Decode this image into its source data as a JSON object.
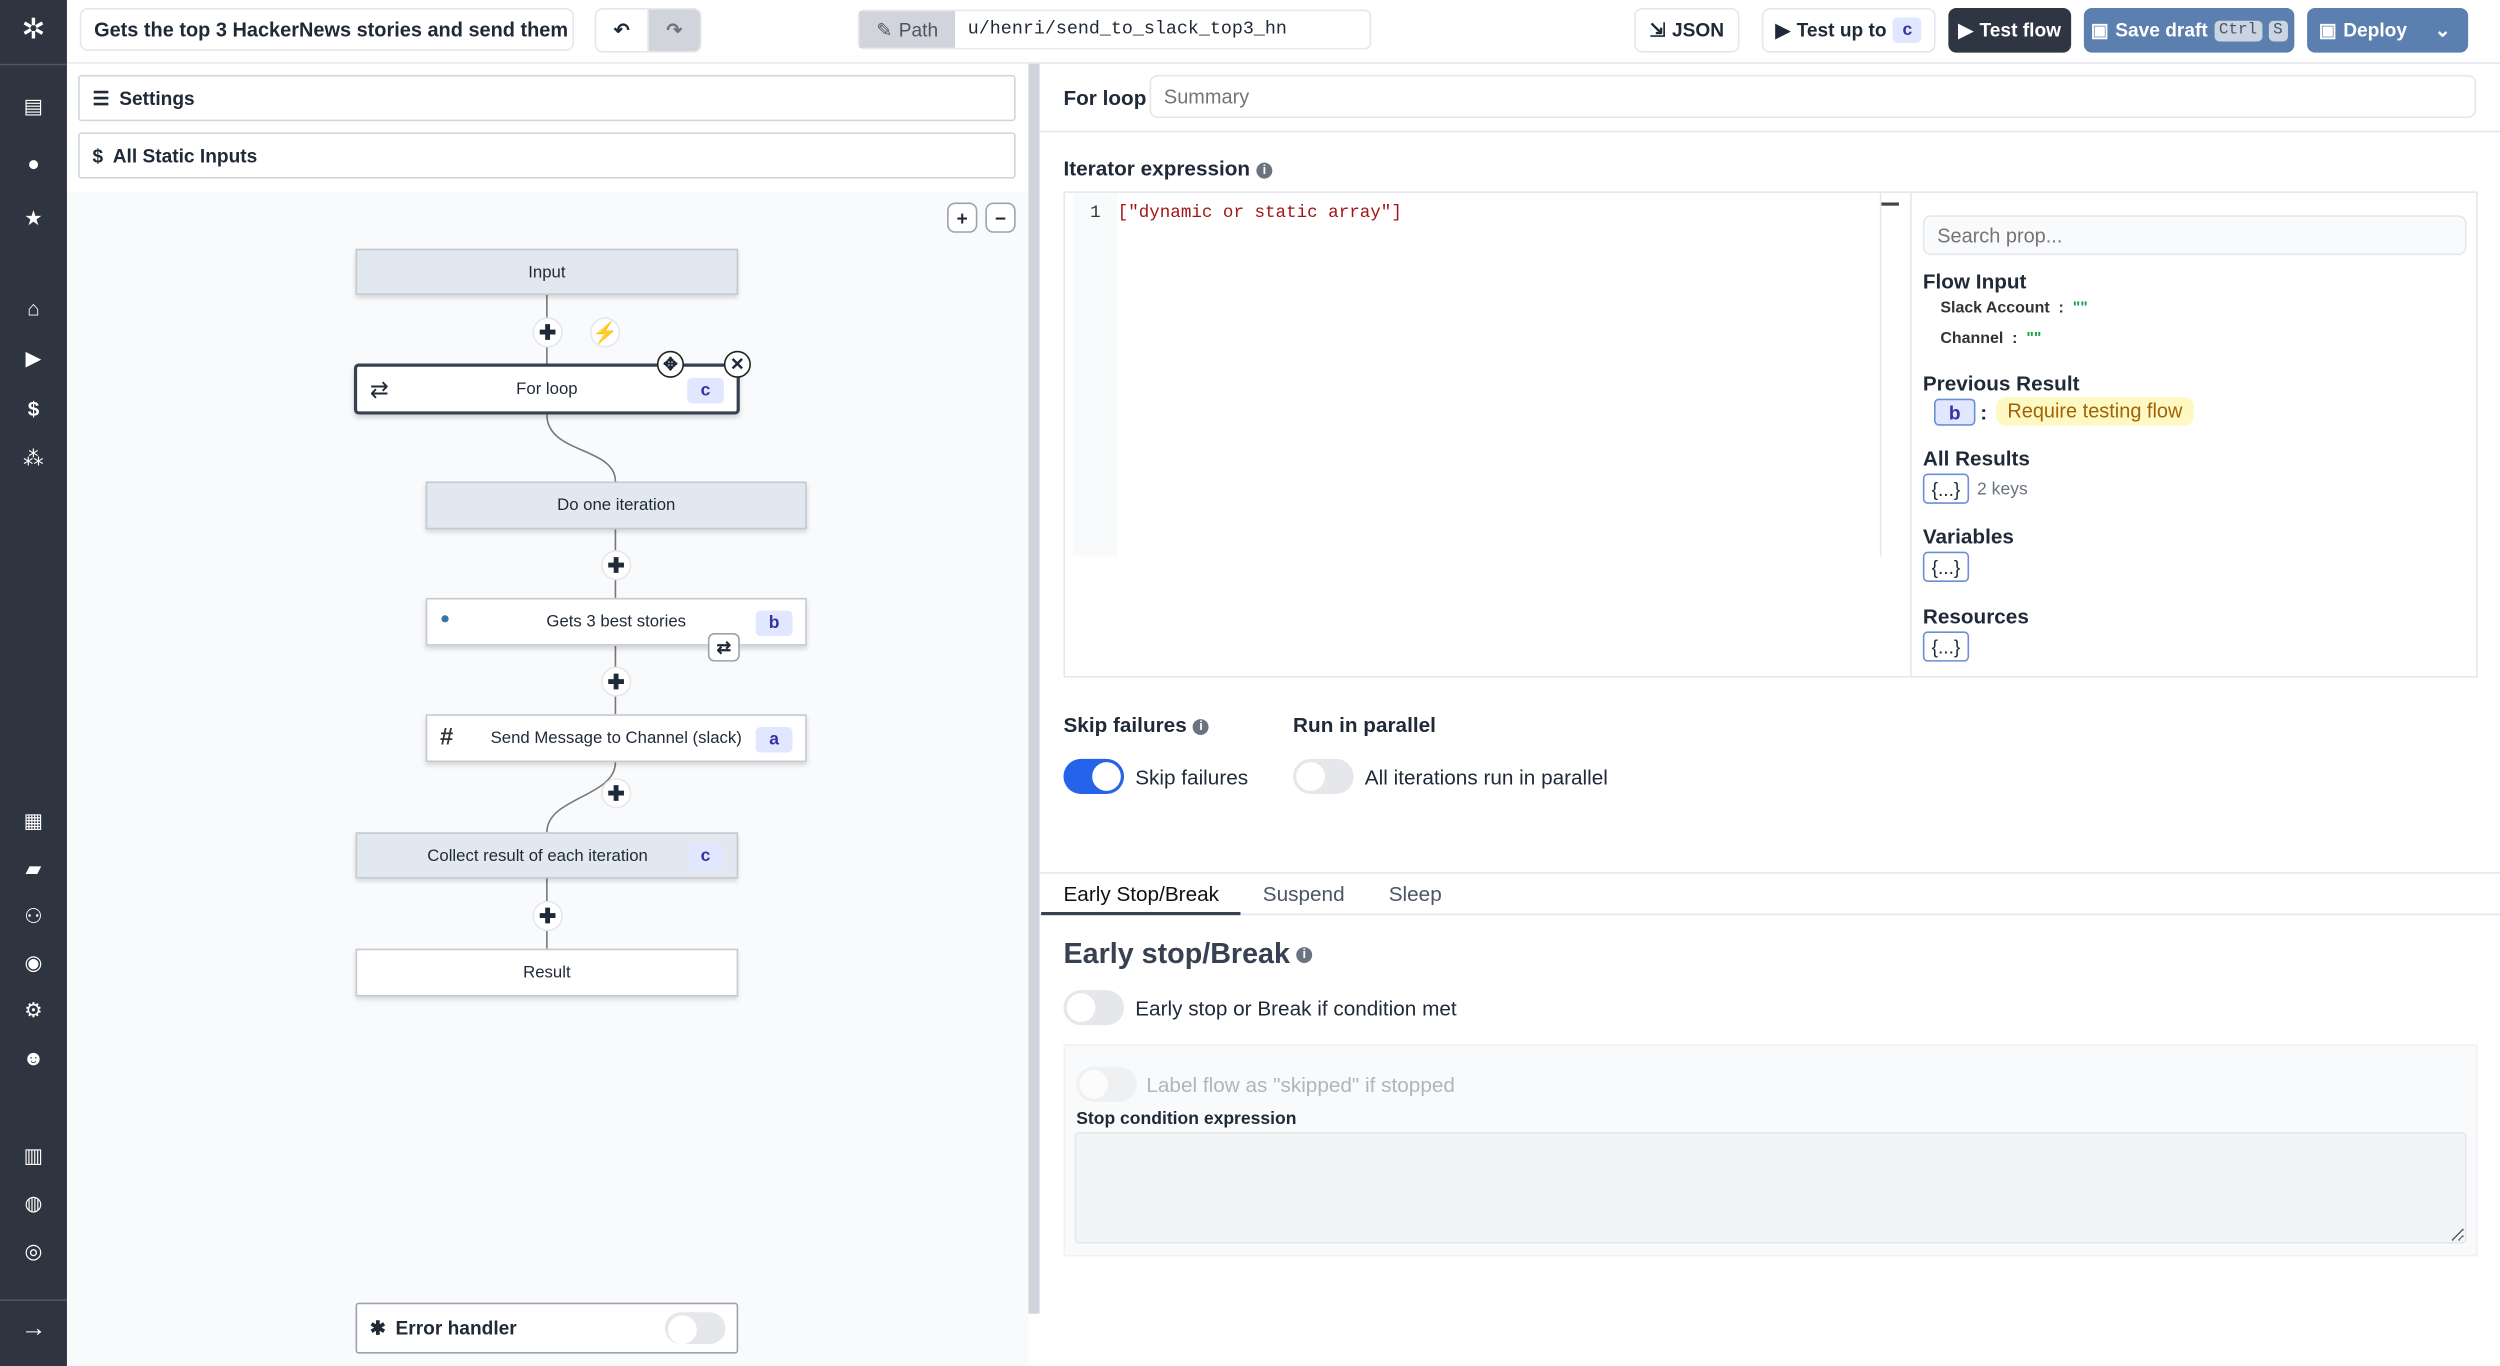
{
  "header": {
    "flow_title": "Gets the top 3 HackerNews stories and send them",
    "path_label": "Path",
    "path_value": "u/henri/send_to_slack_top3_hn",
    "json_label": "JSON",
    "test_up_to_label": "Test up to",
    "test_up_to_step": "c",
    "test_flow_label": "Test flow",
    "save_draft_label": "Save draft",
    "save_draft_kbd": [
      "Ctrl",
      "S"
    ],
    "deploy_label": "Deploy"
  },
  "sidebar": {
    "icons": [
      "windmill-logo",
      "scripts-icon",
      "user-icon",
      "star-icon",
      "home-icon",
      "play-icon",
      "dollar-icon",
      "resources-icon",
      "calendar-icon",
      "folder-icon",
      "groups-icon",
      "eye-icon",
      "gear-icon",
      "robot-icon",
      "book-icon",
      "discord-icon",
      "github-icon",
      "expand-arrow-icon"
    ]
  },
  "left": {
    "settings_label": "Settings",
    "static_inputs_label": "All Static Inputs",
    "error_handler_label": "Error handler",
    "error_handler_enabled": false
  },
  "graph": {
    "nodes": [
      {
        "label": "Input"
      },
      {
        "label": "For loop",
        "id": "c"
      },
      {
        "label": "Do one iteration"
      },
      {
        "label": "Gets 3 best stories",
        "id": "b"
      },
      {
        "label": "Send Message to Channel (slack)",
        "id": "a"
      },
      {
        "label": "Collect result of each iteration",
        "id": "c"
      },
      {
        "label": "Result"
      }
    ]
  },
  "right": {
    "title": "For loop",
    "summary_placeholder": "Summary",
    "iterator_label": "Iterator expression",
    "code_line": "1",
    "code": "[\"dynamic or static array\"]",
    "search_placeholder": "Search prop...",
    "flow_input_label": "Flow Input",
    "flow_inputs": [
      {
        "key": "Slack Account",
        "value": "\"\""
      },
      {
        "key": "Channel",
        "value": "\"\""
      }
    ],
    "previous_result_label": "Previous Result",
    "previous_result_step": "b",
    "previous_result_value": "Require testing flow",
    "all_results_label": "All Results",
    "obj": "{...}",
    "all_results_keys": "2 keys",
    "variables_label": "Variables",
    "resources_label": "Resources",
    "skip_failures_label": "Skip failures",
    "skip_failures_toggle": "Skip failures",
    "skip_failures_on": true,
    "parallel_label": "Run in parallel",
    "parallel_toggle": "All iterations run in parallel",
    "parallel_on": false,
    "tabs": [
      "Early Stop/Break",
      "Suspend",
      "Sleep"
    ],
    "active_tab": "Early Stop/Break",
    "early_stop_title": "Early stop/Break",
    "early_stop_toggle": "Early stop or Break if condition met",
    "skipped_toggle": "Label flow as \"skipped\" if stopped",
    "stop_condition_label": "Stop condition expression"
  },
  "colors": {
    "sidebar": "#2e3440",
    "primary": "#2563eb",
    "save": "#5b7fae",
    "dark_button": "#2e3644",
    "badge_bg": "#e0e7ff",
    "badge_fg": "#3730a3",
    "warn_bg": "#fef9c3",
    "warn_fg": "#a16207"
  }
}
